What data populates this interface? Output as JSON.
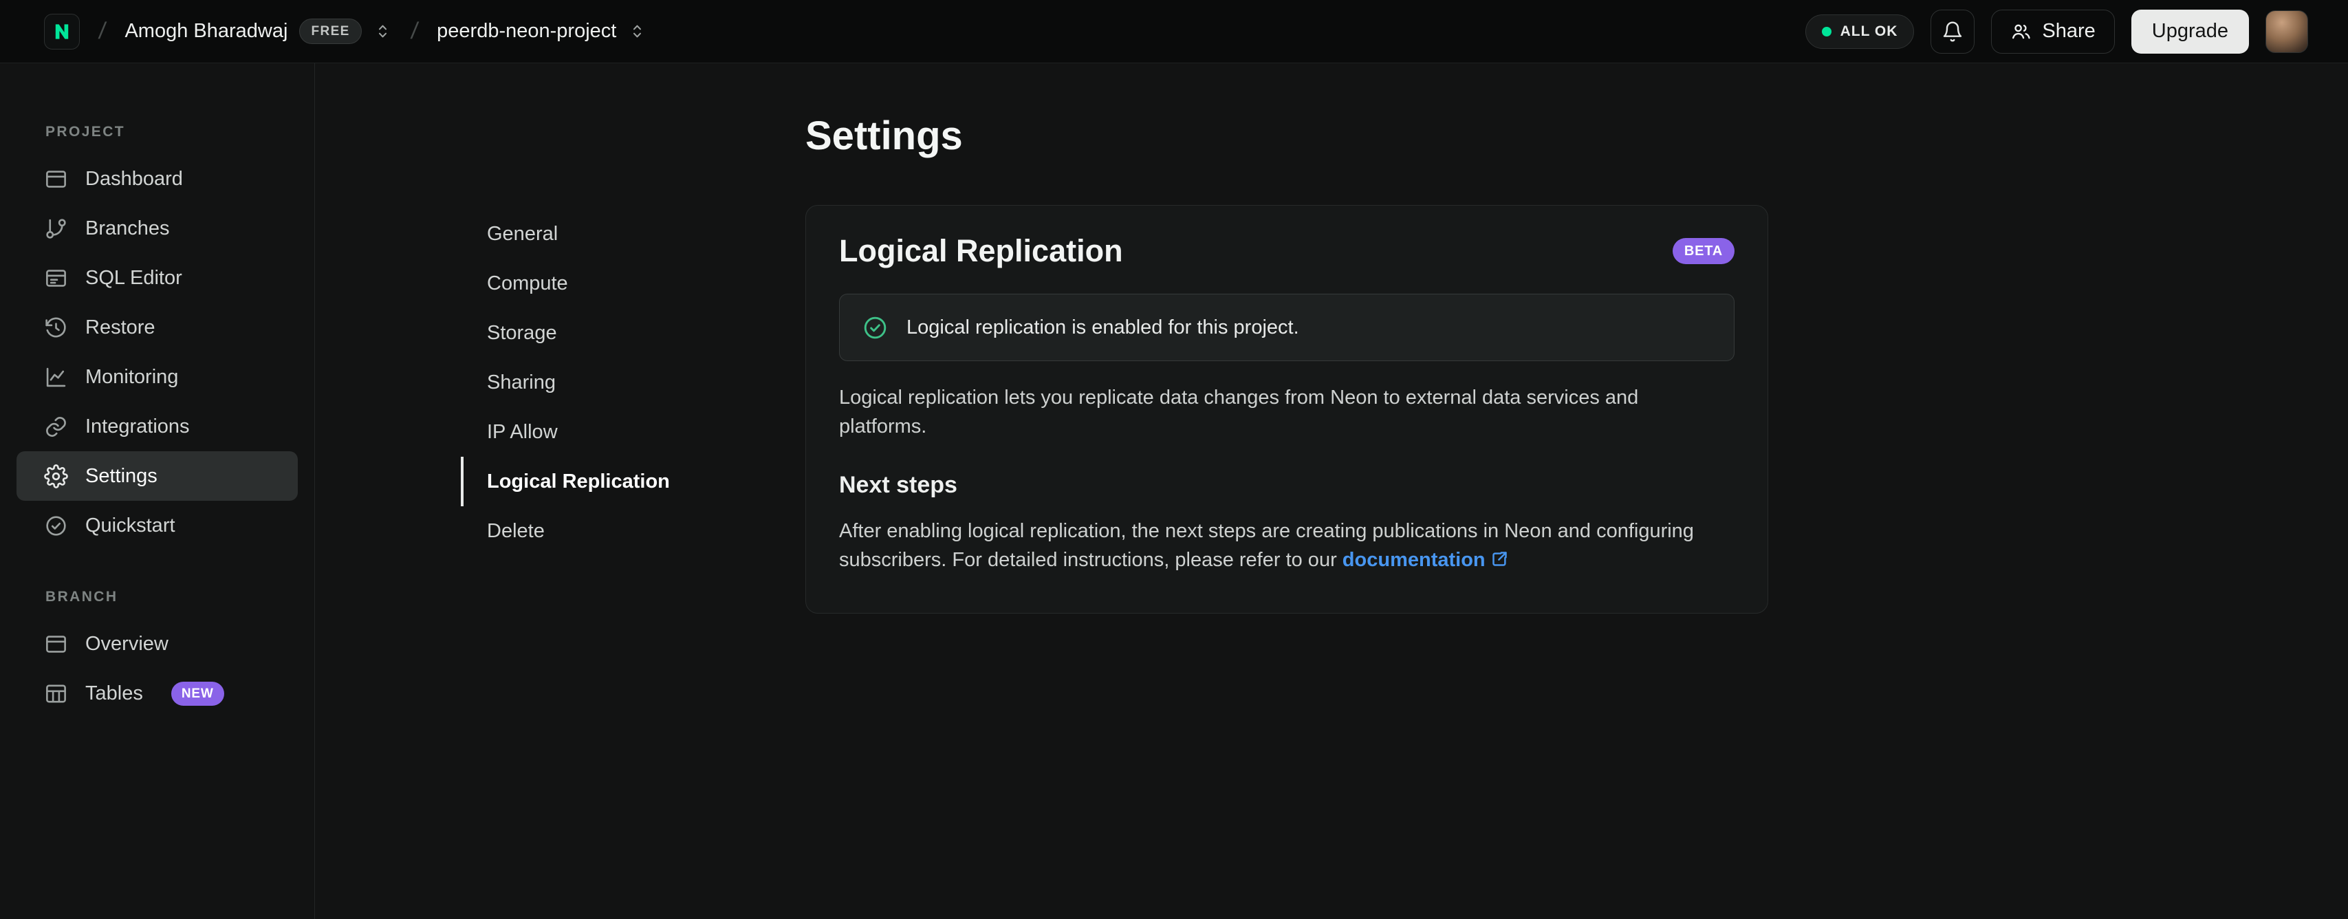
{
  "header": {
    "org": "Amogh Bharadwaj",
    "org_badge": "FREE",
    "project": "peerdb-neon-project",
    "status": "ALL OK",
    "share": "Share",
    "upgrade": "Upgrade"
  },
  "sidebar": {
    "project_label": "PROJECT",
    "branch_label": "BRANCH",
    "project_items": [
      {
        "label": "Dashboard",
        "icon": "dashboard-icon",
        "active": false
      },
      {
        "label": "Branches",
        "icon": "git-branch-icon",
        "active": false
      },
      {
        "label": "SQL Editor",
        "icon": "sql-editor-icon",
        "active": false
      },
      {
        "label": "Restore",
        "icon": "restore-history-icon",
        "active": false
      },
      {
        "label": "Monitoring",
        "icon": "monitoring-chart-icon",
        "active": false
      },
      {
        "label": "Integrations",
        "icon": "integrations-icon",
        "active": false
      },
      {
        "label": "Settings",
        "icon": "gear-icon",
        "active": true
      },
      {
        "label": "Quickstart",
        "icon": "check-circle-icon",
        "active": false
      }
    ],
    "branch_items": [
      {
        "label": "Overview",
        "icon": "overview-icon",
        "badge": ""
      },
      {
        "label": "Tables",
        "icon": "tables-icon",
        "badge": "NEW"
      }
    ]
  },
  "main": {
    "title": "Settings",
    "nav": [
      "General",
      "Compute",
      "Storage",
      "Sharing",
      "IP Allow",
      "Logical Replication",
      "Delete"
    ],
    "active_nav": "Logical Replication",
    "card": {
      "title": "Logical Replication",
      "badge": "BETA",
      "alert": "Logical replication is enabled for this project.",
      "description": "Logical replication lets you replicate data changes from Neon to external data services and platforms.",
      "next_steps_title": "Next steps",
      "next_steps_text_before": "After enabling logical replication, the next steps are creating publications in Neon and configuring subscribers. For detailed instructions, please refer to our ",
      "next_steps_link": "documentation"
    }
  },
  "colors": {
    "brand_green": "#00e599",
    "status_dot_green": "#00e599",
    "badge_purple": "#8a63e8",
    "link_blue": "#4896f0",
    "success_icon_green": "#3ec188"
  }
}
